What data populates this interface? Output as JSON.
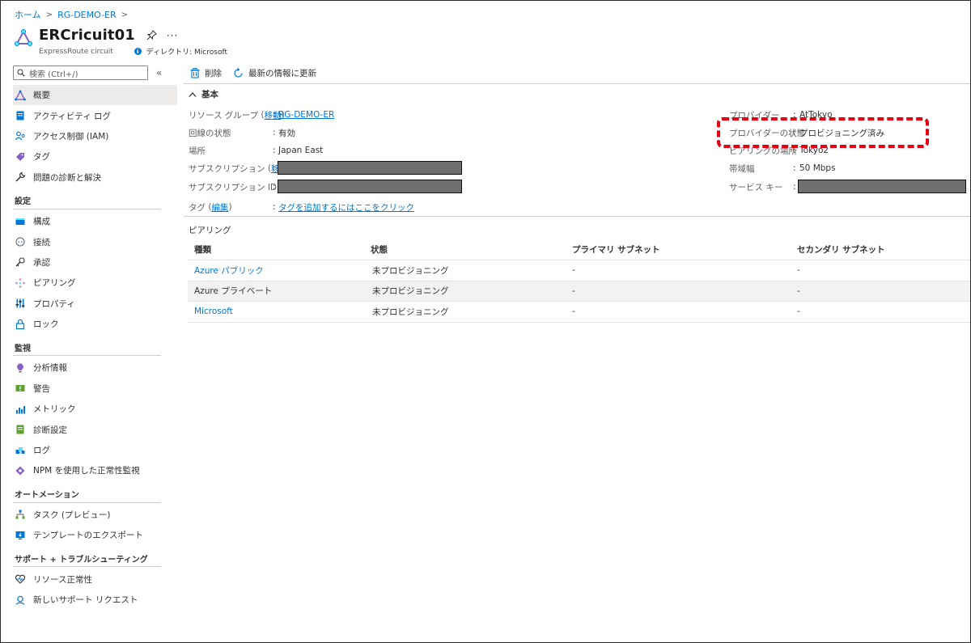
{
  "breadcrumb": {
    "home": "ホーム",
    "resource_group": "RG-DEMO-ER",
    "sep": ">"
  },
  "header": {
    "title": "ERCricuit01",
    "resource_type": "ExpressRoute circuit",
    "directory": "ディレクトリ: Microsoft",
    "more": "···"
  },
  "sidebar": {
    "search_placeholder": "検索 (Ctrl+/)",
    "collapse": "«",
    "top_items": [
      {
        "label": "概要",
        "icon": "triangle-icon"
      },
      {
        "label": "アクティビティ ログ",
        "icon": "activity-log-icon"
      },
      {
        "label": "アクセス制御 (IAM)",
        "icon": "iam-icon"
      },
      {
        "label": "タグ",
        "icon": "tag-icon"
      },
      {
        "label": "問題の診断と解決",
        "icon": "wrench-icon"
      }
    ],
    "sections": [
      {
        "title": "設定",
        "items": [
          {
            "label": "構成",
            "icon": "configuration-icon"
          },
          {
            "label": "接続",
            "icon": "connection-icon"
          },
          {
            "label": "承認",
            "icon": "key-icon"
          },
          {
            "label": "ピアリング",
            "icon": "peering-icon"
          },
          {
            "label": "プロパティ",
            "icon": "properties-icon"
          },
          {
            "label": "ロック",
            "icon": "lock-icon"
          }
        ]
      },
      {
        "title": "監視",
        "items": [
          {
            "label": "分析情報",
            "icon": "insights-icon"
          },
          {
            "label": "警告",
            "icon": "alert-icon"
          },
          {
            "label": "メトリック",
            "icon": "metrics-icon"
          },
          {
            "label": "診断設定",
            "icon": "diagnostic-settings-icon"
          },
          {
            "label": "ログ",
            "icon": "logs-icon"
          },
          {
            "label": "NPM を使用した正常性監視",
            "icon": "npm-icon"
          }
        ]
      },
      {
        "title": "オートメーション",
        "items": [
          {
            "label": "タスク (プレビュー)",
            "icon": "tasks-icon"
          },
          {
            "label": "テンプレートのエクスポート",
            "icon": "export-template-icon"
          }
        ]
      },
      {
        "title": "サポート + トラブルシューティング",
        "items": [
          {
            "label": "リソース正常性",
            "icon": "resource-health-icon"
          },
          {
            "label": "新しいサポート リクエスト",
            "icon": "support-request-icon"
          }
        ]
      }
    ]
  },
  "commands": {
    "delete": "削除",
    "refresh": "最新の情報に更新"
  },
  "essentials": {
    "heading": "基本",
    "left": {
      "rg_label": "リソース グループ",
      "rg_move": "移動",
      "rg_value": "RG-DEMO-ER",
      "status_label": "回線の状態",
      "status_value": "有効",
      "location_label": "場所",
      "location_value": "Japan East",
      "sub_label": "サブスクリプション",
      "sub_move": "移動",
      "subid_label": "サブスクリプション ID",
      "tags_label": "タグ",
      "tags_edit": "編集",
      "tags_value": "タグを追加するにはここをクリック"
    },
    "right": {
      "provider_label": "プロバイダー",
      "provider_value": "AtTokyo",
      "provider_status_label": "プロバイダーの状態",
      "provider_status_value": "プロビジョニング済み",
      "peering_location_label": "ピアリングの場所",
      "peering_location_value": "Tokyo2",
      "bandwidth_label": "帯域幅",
      "bandwidth_value": "50 Mbps",
      "service_key_label": "サービス キー"
    },
    "colon": ":"
  },
  "peering": {
    "title": "ピアリング",
    "columns": [
      "種類",
      "状態",
      "プライマリ サブネット",
      "セカンダリ サブネット"
    ],
    "rows": [
      {
        "type": "Azure パブリック",
        "status": "未プロビジョニング",
        "primary": "-",
        "secondary": "-"
      },
      {
        "type": "Azure プライベート",
        "status": "未プロビジョニング",
        "primary": "-",
        "secondary": "-"
      },
      {
        "type": "Microsoft",
        "status": "未プロビジョニング",
        "primary": "-",
        "secondary": "-"
      }
    ]
  },
  "colors": {
    "accent": "#0078d4",
    "callout": "#e60012",
    "active_bg": "#edebe9"
  }
}
